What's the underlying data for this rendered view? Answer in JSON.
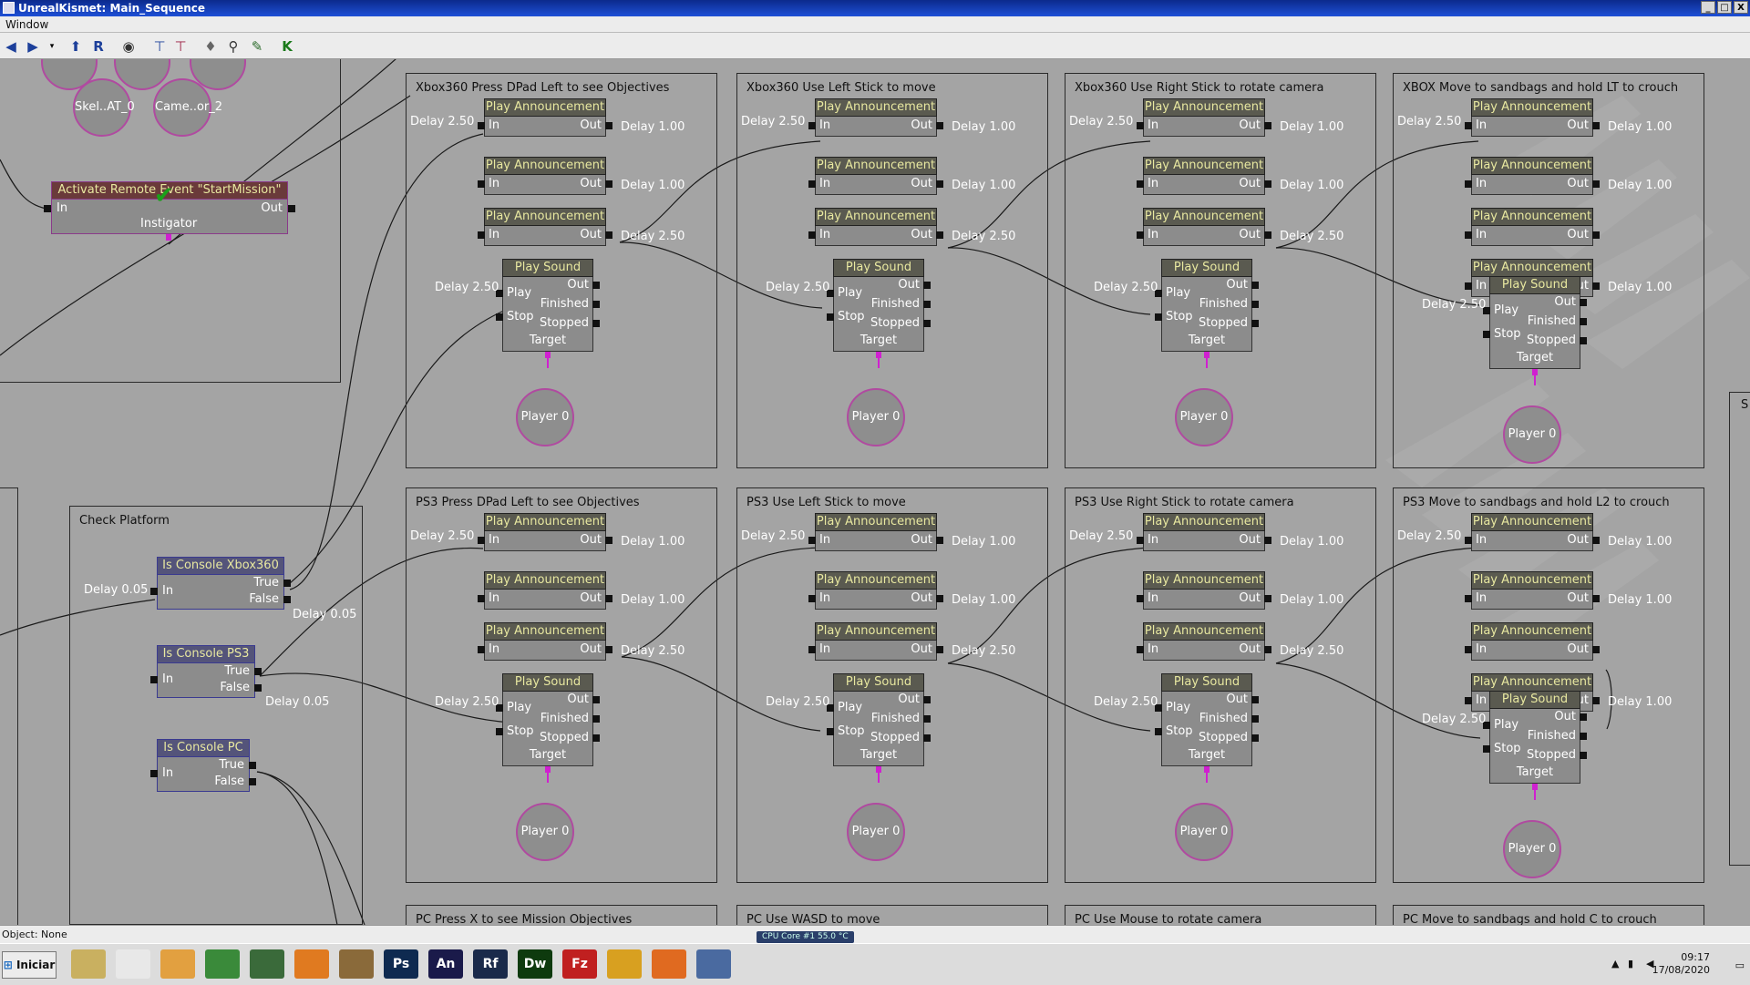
{
  "window": {
    "title": "UnrealKismet: Main_Sequence",
    "controls": [
      "_",
      "□",
      "X"
    ]
  },
  "menu": {
    "items": [
      "Window"
    ]
  },
  "toolbar": {
    "icons": [
      "back-arrow-icon",
      "forward-arrow-icon",
      "dropdown-icon",
      "parent-sequence-icon",
      "rename-icon",
      "hide-icon",
      "tree-icon",
      "tree-alt-icon",
      "bulb-icon",
      "search-icon",
      "wrench-icon",
      "kismet-icon"
    ]
  },
  "labels": {
    "play_announcement": "Play Announcement",
    "play_sound": "Play Sound",
    "in": "In",
    "out": "Out",
    "play": "Play",
    "stop": "Stop",
    "finished": "Finished",
    "stopped": "Stopped",
    "target": "Target",
    "player0": "Player 0",
    "true": "True",
    "false": "False",
    "instigator": "Instigator"
  },
  "top_left": {
    "var1": "Skel..AT_0",
    "var2": "Came..or_2",
    "event_title": "Activate Remote Event \"StartMission\""
  },
  "check_platform": {
    "title": "Check Platform",
    "nodes": [
      "Is Console Xbox360",
      "Is Console PS3",
      "Is Console PC"
    ],
    "delays": [
      "Delay 0.05",
      "Delay 0.05",
      "Delay 0.05"
    ]
  },
  "frames": [
    {
      "title": "Xbox360 Press DPad Left to see Objectives",
      "delays": [
        "Delay 2.50",
        "Delay 1.00",
        "Delay 1.00",
        "Delay 2.50",
        "Delay 2.50"
      ]
    },
    {
      "title": "Xbox360 Use Left Stick to move",
      "delays": [
        "Delay 2.50",
        "Delay 1.00",
        "Delay 1.00",
        "Delay 2.50",
        "Delay 2.50"
      ]
    },
    {
      "title": "Xbox360 Use Right Stick to rotate camera",
      "delays": [
        "Delay 2.50",
        "Delay 1.00",
        "Delay 1.00",
        "Delay 2.50",
        "Delay 2.50"
      ]
    },
    {
      "title": "XBOX Move to sandbags and hold LT to crouch",
      "delays": [
        "Delay 2.50",
        "Delay 1.00",
        "Delay 1.00",
        "Delay 1.00",
        "Delay 2.50"
      ]
    },
    {
      "title": "PS3 Press DPad Left to see Objectives",
      "delays": [
        "Delay 2.50",
        "Delay 1.00",
        "Delay 1.00",
        "Delay 2.50",
        "Delay 2.50"
      ]
    },
    {
      "title": "PS3 Use Left Stick to move",
      "delays": [
        "Delay 2.50",
        "Delay 1.00",
        "Delay 1.00",
        "Delay 2.50",
        "Delay 2.50"
      ]
    },
    {
      "title": "PS3 Use Right Stick to rotate camera",
      "delays": [
        "Delay 2.50",
        "Delay 1.00",
        "Delay 1.00",
        "Delay 2.50",
        "Delay 2.50"
      ]
    },
    {
      "title": "PS3 Move to sandbags and hold L2 to crouch",
      "delays": [
        "Delay 2.50",
        "Delay 1.00",
        "Delay 1.00",
        "Delay 1.00",
        "Delay 2.50"
      ]
    },
    {
      "title": "PC Press X to see Mission Objectives"
    },
    {
      "title": "PC Use WASD to move"
    },
    {
      "title": "PC Use Mouse to rotate camera"
    },
    {
      "title": "PC Move to sandbags and hold C to crouch"
    }
  ],
  "status": {
    "text": "Object: None",
    "cpu": "CPU Core #1     55.0 °C"
  },
  "taskbar": {
    "start": "Iniciar",
    "apps": [
      {
        "label": "",
        "color": "#c9b060"
      },
      {
        "label": "",
        "color": "#e8e8e8"
      },
      {
        "label": "",
        "color": "#e2a040"
      },
      {
        "label": "",
        "color": "#3a8a3a"
      },
      {
        "label": "",
        "color": "#3a6a3a"
      },
      {
        "label": "",
        "color": "#e07a20"
      },
      {
        "label": "",
        "color": "#8a6a3a"
      },
      {
        "label": "Ps",
        "color": "#0e2a50"
      },
      {
        "label": "An",
        "color": "#1a1a4a"
      },
      {
        "label": "Rf",
        "color": "#1a2a4a"
      },
      {
        "label": "Dw",
        "color": "#0e3a0e"
      },
      {
        "label": "Fz",
        "color": "#c02020"
      },
      {
        "label": "",
        "color": "#d8a020"
      },
      {
        "label": "",
        "color": "#e06a20"
      },
      {
        "label": "",
        "color": "#4a6aa0"
      }
    ],
    "time": "09:17",
    "date": "17/08/2020"
  }
}
